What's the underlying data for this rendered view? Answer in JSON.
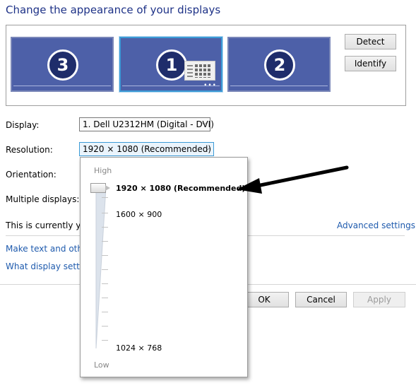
{
  "heading": "Change the appearance of your displays",
  "monitors": [
    {
      "number": "3",
      "selected": false
    },
    {
      "number": "1",
      "selected": true
    },
    {
      "number": "2",
      "selected": false
    }
  ],
  "buttons": {
    "detect": "Detect",
    "identify": "Identify",
    "ok": "OK",
    "cancel": "Cancel",
    "apply": "Apply"
  },
  "fields": {
    "display_label": "Display:",
    "display_value": "1. Dell U2312HM (Digital - DVI)",
    "resolution_label": "Resolution:",
    "resolution_value": "1920 × 1080 (Recommended)",
    "orientation_label": "Orientation:",
    "multiple_displays_label": "Multiple displays:"
  },
  "status_text": "This is currently you",
  "links": {
    "advanced_settings": "Advanced settings",
    "make_text": "Make text and other",
    "what_display": "What display setting"
  },
  "resolution_popup": {
    "high_label": "High",
    "low_label": "Low",
    "options": {
      "top": "1920 × 1080 (Recommended)",
      "mid": "1600 × 900",
      "bottom": "1024 × 768"
    },
    "selected": "1920 × 1080 (Recommended)"
  },
  "colors": {
    "heading": "#1e3287",
    "monitor_fill": "#4d60a8",
    "link": "#1e5aad",
    "annotation_arrow": "#000000"
  }
}
